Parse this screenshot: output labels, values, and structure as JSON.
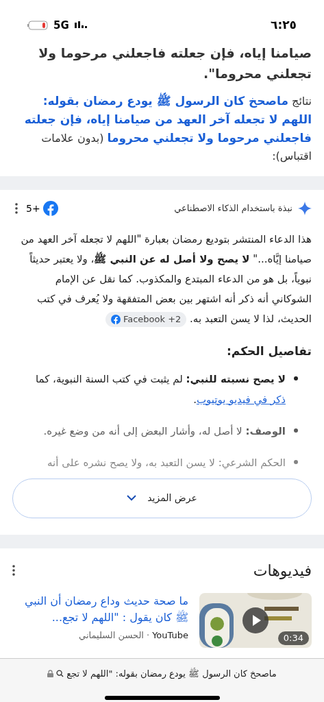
{
  "status_bar": {
    "time": "٦:٢٥",
    "network": "5G"
  },
  "top_text": "صيامنا إياه، فإن جعلته فاجعلني مرحوما ولا تجعلني محروما\".",
  "results_note": [
    {
      "kind": "plain",
      "text": "نتائج "
    },
    {
      "kind": "link",
      "text": "ماصحخ كان الرسول ﷺ يودع رمضان بقوله: اللهم لا تجعله آخر العهد من صيامنا إياه، فإن جعلته فاجعلني مرحوما ولا تجعلني محروما"
    },
    {
      "kind": "plain",
      "text": " (بدون علامات اقتباس):"
    }
  ],
  "ai_overview": {
    "label": "نبذة باستخدام الذكاء الاصطناعي",
    "sources_count": "5+",
    "paragraph": "هذا الدعاء المنتشر بتوديع رمضان بعبارة \"اللهم لا تجعله آخر العهد من صيامنا إيَّاه...\" **لا يصح ولا أصل له عن النبي ﷺ**، ولا يعتبر حديثاً نبوياً، بل هو من الدعاء المبتدع والمكذوب. كما نقل عن الإمام الشوكاني أنه ذكر أنه اشتهر بين بعض المتفقهة ولا يُعرف في كتب الحديث، لذا لا يسن التعبد به.",
    "source_chip": "Facebook +2",
    "heading": "تفاصيل الحكم:",
    "bullets": [
      {
        "text": "**لا يصح نسبته للنبي:** لم يثبت في كتب السنة النبوية، كما ",
        "link": "ذكر في فيديو يوتيوب",
        "after": "."
      },
      {
        "text": "**الوصف:** لا أصل له، وأشار البعض إلى أنه من وضع غيره."
      },
      {
        "text": "الحكم الشرعي: لا يسن التعبد به، ولا يصح نشره على أنه"
      }
    ],
    "show_more": "عرض المزيد"
  },
  "videos": {
    "title": "فيديوهات",
    "items": [
      {
        "title": "ما صحة حديث وداع رمضان أن النبي ﷺ كان يقول : \"اللهم لا تجع...",
        "source": "YouTube",
        "separator": "·",
        "author": "الحسن السليماني",
        "duration": "0:34"
      }
    ]
  },
  "address_bar": {
    "text": "ماصحخ كان الرسول ﷺ يودع رمضان بقوله: \"اللهم لا تجع"
  }
}
